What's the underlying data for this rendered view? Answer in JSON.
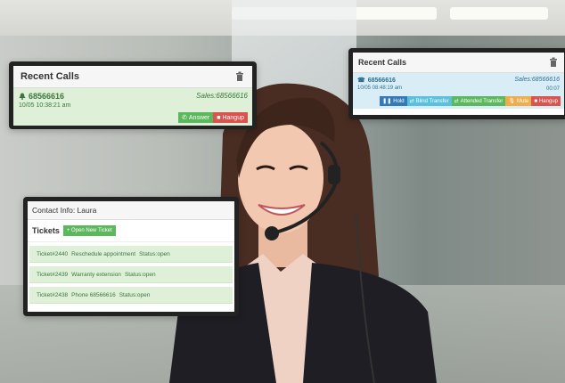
{
  "recent_calls_1": {
    "title": "Recent Calls",
    "number": "68566616",
    "queue": "Sales:68566616",
    "timestamp": "10/05 10:38:21 am",
    "answer_label": "Answer",
    "hangup_label": "Hangup"
  },
  "recent_calls_2": {
    "title": "Recent Calls",
    "number": "68566616",
    "queue": "Sales:68566616",
    "timestamp": "10/05 08:48:19 am",
    "duration": "00:07",
    "hold_label": "Hold",
    "blind_transfer_label": "Blind Transfer",
    "attended_transfer_label": "Attended Transfer",
    "mute_label": "Mute",
    "hangup_label": "Hangup"
  },
  "contact": {
    "title": "Contact Info: Laura",
    "tickets_title": "Tickets",
    "new_ticket_label": "Open New Ticket",
    "tickets": [
      {
        "id": "Ticket#2440",
        "subject": "Reschedule appointment",
        "status": "Status:open"
      },
      {
        "id": "Ticket#2439",
        "subject": "Warranty extension",
        "status": "Status:open"
      },
      {
        "id": "Ticket#2438",
        "subject": "Phone 68566616",
        "status": "Status:open"
      }
    ]
  },
  "colors": {
    "success_bg": "#dff0d8",
    "info_bg": "#d9edf7",
    "btn_green": "#5cb85c",
    "btn_red": "#d9534f",
    "btn_blue": "#337ab7",
    "btn_teal": "#5bc0de",
    "btn_orange": "#f0ad4e"
  }
}
